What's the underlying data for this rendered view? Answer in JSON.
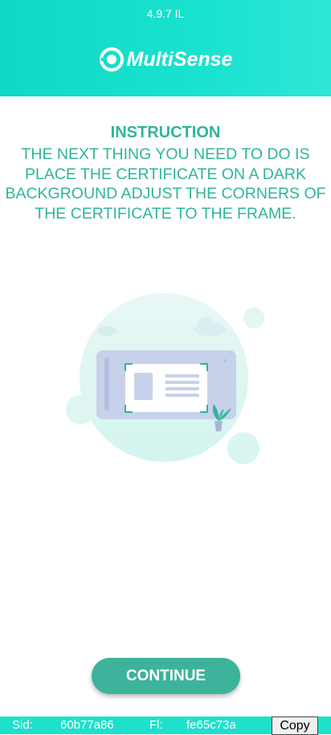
{
  "header": {
    "version": "4.9.7 IL",
    "brand_name": "MultiSense",
    "background_color": "#19e2cf"
  },
  "instruction": {
    "title": "INSTRUCTION",
    "lines": [
      "THE NEXT THING YOU NEED TO DO IS",
      "PLACE THE CERTIFICATE ON A DARK",
      "BACKGROUND ADJUST THE CORNERS OF",
      "THE CERTIFICATE TO THE FRAME."
    ],
    "text_color": "#2fb59a"
  },
  "illustration": {
    "icon": "phone-scanning-certificate-illustration"
  },
  "actions": {
    "continue_label": "CONTINUE",
    "continue_color": "#3db39c"
  },
  "footer": {
    "sid_label": "Sid:",
    "sid_value": "60b77a86",
    "fl_label": "Fl:",
    "fl_value": "fe65c73a",
    "copy_label": "Copy"
  }
}
